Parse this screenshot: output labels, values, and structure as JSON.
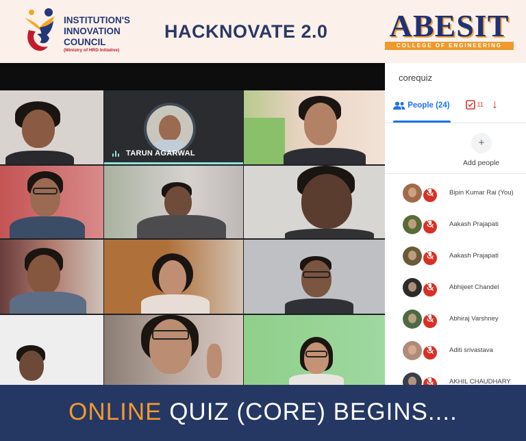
{
  "banner": {
    "iic_line1": "INSTITUTION'S",
    "iic_line2": "INNOVATION",
    "iic_line3": "COUNCIL",
    "iic_sub": "(Ministry of HRD Initiative)",
    "event_title": "HACKNOVATE 2.0",
    "college_name": "ABESIT",
    "college_sub": "COLLEGE OF ENGINEERING"
  },
  "meet": {
    "active_speaker": "TARUN AGARWAL"
  },
  "panel": {
    "meeting_code": "corequiz",
    "people_tab": "People (24)",
    "chat_count": "11",
    "add_people": "Add people",
    "participants": [
      {
        "name": "Bipin Kumar Rai (You)",
        "color": "#a06b4a"
      },
      {
        "name": "Aakash Prajapati",
        "color": "#5a6b3a"
      },
      {
        "name": "Aakash Prajapati",
        "color": "#6a5a3a"
      },
      {
        "name": "Abhijeet Chandel",
        "color": "#2b2b2b"
      },
      {
        "name": "Abhiraj Varshney",
        "color": "#4d6a45"
      },
      {
        "name": "Aditi srivastava",
        "color": "#b08a7a"
      },
      {
        "name": "AKHIL CHAUDHARY",
        "color": "#3a3f4a"
      }
    ]
  },
  "footer": {
    "highlight": "ONLINE",
    "rest": " QUIZ (CORE) BEGINS...."
  },
  "colors": {
    "brand_navy": "#253763",
    "accent_orange": "#f39a2e",
    "meet_blue": "#1a73e8",
    "mute_red": "#d93025"
  }
}
